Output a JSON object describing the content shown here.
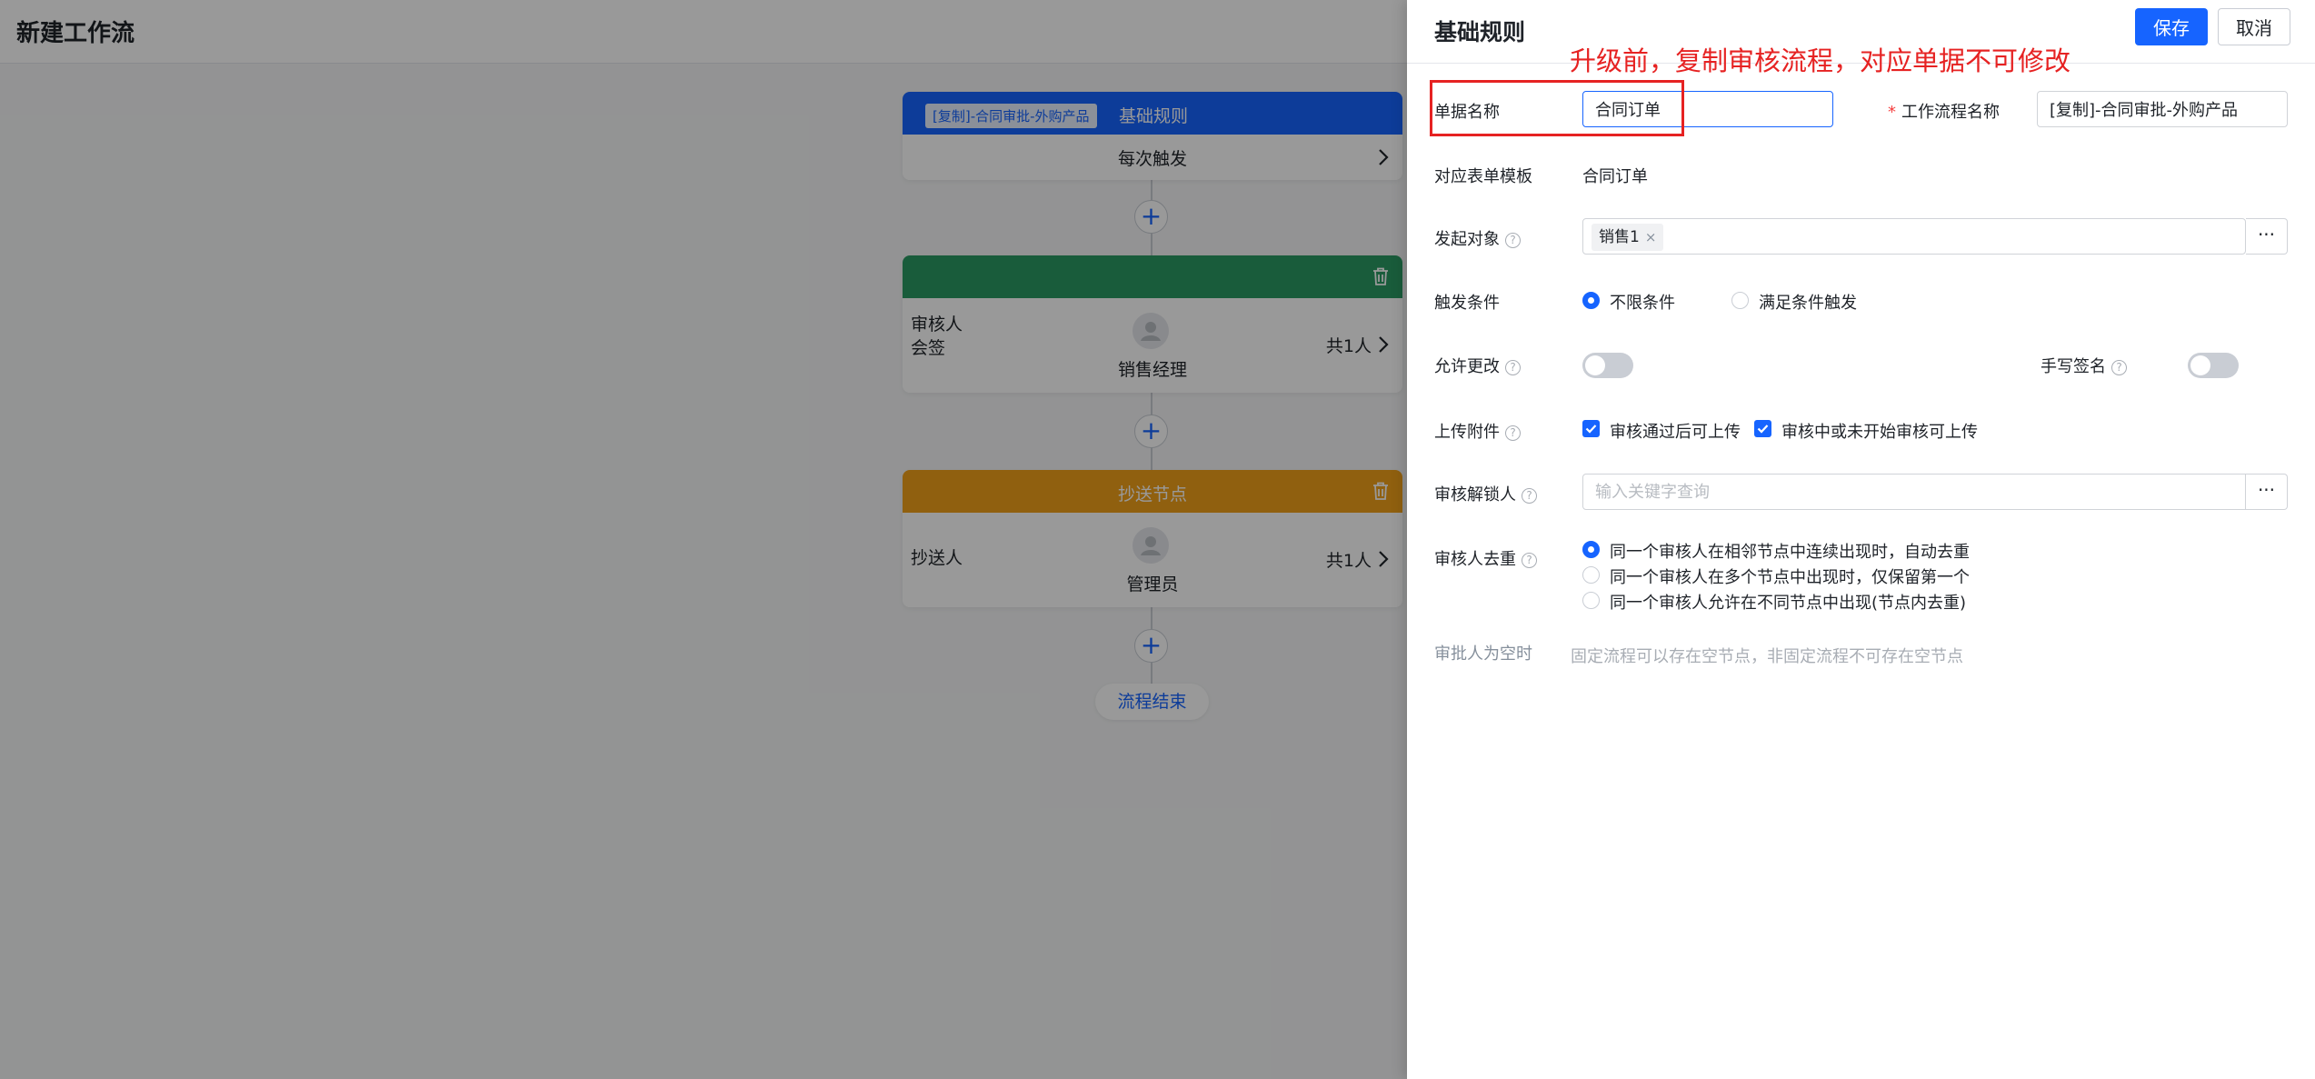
{
  "page": {
    "title": "新建工作流"
  },
  "flow": {
    "basic_node": {
      "tag": "[复制]-合同审批-外购产品",
      "title": "基础规则",
      "trigger": "每次触发"
    },
    "approve_node": {
      "header": "",
      "role": "审核人",
      "mode": "会签",
      "person": "销售经理",
      "count": "共1人"
    },
    "cc_node": {
      "header": "抄送节点",
      "role": "抄送人",
      "person": "管理员",
      "count": "共1人"
    },
    "add_symbol": "+",
    "end": "流程结束"
  },
  "drawer": {
    "title": "基础规则",
    "save_label": "保存",
    "cancel_label": "取消",
    "doc_name": {
      "label": "单据名称",
      "value": "合同订单"
    },
    "workflow_name": {
      "required_mark": "*",
      "label": "工作流程名称",
      "value": "[复制]-合同审批-外购产品"
    },
    "form_template": {
      "label": "对应表单模板",
      "value": "合同订单"
    },
    "initiator": {
      "label": "发起对象",
      "tag": "销售1",
      "tag_close": "×",
      "more": "···"
    },
    "trigger": {
      "label": "触发条件",
      "options": [
        "不限条件",
        "满足条件触发"
      ],
      "selected": 0
    },
    "allow_change": {
      "label": "允许更改",
      "on": false
    },
    "handwritten_sign": {
      "label": "手写签名",
      "on": false
    },
    "upload": {
      "label": "上传附件",
      "options": [
        "审核通过后可上传",
        "审核中或未开始审核可上传"
      ],
      "checked": [
        true,
        true
      ]
    },
    "unlocker": {
      "label": "审核解锁人",
      "placeholder": "输入关键字查询",
      "more": "···"
    },
    "dedupe": {
      "label": "审核人去重",
      "options": [
        "同一个审核人在相邻节点中连续出现时，自动去重",
        "同一个审核人在多个节点中出现时，仅保留第一个",
        "同一个审核人允许在不同节点中出现(节点内去重)"
      ],
      "selected": 0
    },
    "empty_approver": {
      "label": "审批人为空时",
      "hint": "固定流程可以存在空节点，非固定流程不可存在空节点"
    },
    "help_symbol": "?"
  },
  "annotation": {
    "text": "升级前，复制审核流程，对应单据不可修改",
    "color": "#e62222"
  },
  "colors": {
    "primary": "#1664ff",
    "approve": "#2a9a63",
    "cc": "#f0a01a"
  }
}
